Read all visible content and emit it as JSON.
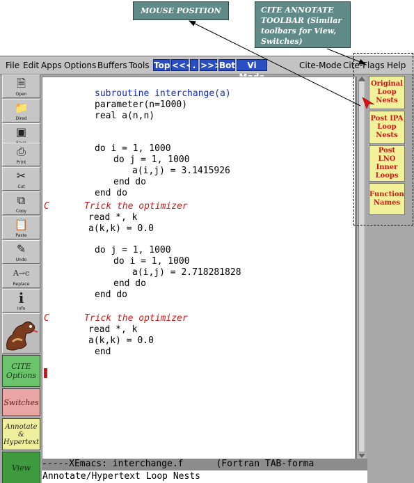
{
  "callouts": {
    "mouse_position": "MOUSE POSITION",
    "toolbar_lines": [
      "CITE ANNOTATE",
      "TOOLBAR (Similar",
      "toolbars for View,",
      "Switches)"
    ]
  },
  "menubar": {
    "items": [
      "File",
      "Edit",
      "Apps",
      "Options",
      "Buffers",
      "Tools"
    ],
    "buttons": [
      "Top",
      "<<<",
      ".",
      ">>>",
      "Bot",
      "Vi Mode"
    ],
    "right_items": [
      "Cite-Mode",
      "Cite-Flags",
      "Help"
    ]
  },
  "toolbar": {
    "tools": [
      {
        "label": "Open",
        "icon": "open-icon"
      },
      {
        "label": "Dired",
        "icon": "dired-icon"
      },
      {
        "label": "Save",
        "icon": "save-icon"
      },
      {
        "label": "Print",
        "icon": "print-icon"
      },
      {
        "label": "Cut",
        "icon": "cut-icon"
      },
      {
        "label": "Copy",
        "icon": "copy-icon"
      },
      {
        "label": "Paste",
        "icon": "paste-icon"
      },
      {
        "label": "Undo",
        "icon": "undo-icon"
      },
      {
        "label": "Replace",
        "icon": "replace-icon"
      },
      {
        "label": "Info",
        "icon": "info-icon"
      }
    ],
    "mascot": "xemacs-mascot",
    "cite_options": [
      "CITE",
      "Options"
    ],
    "switches": "Switches",
    "annotate": [
      "Annotate",
      "&",
      "Hypertext"
    ],
    "view": "View"
  },
  "editor": {
    "lines": [
      "subroutine interchange(a)",
      "parameter(n=1000)",
      "real a(n,n)",
      "do i = 1, 1000",
      "do j = 1, 1000",
      "a(i,j) = 3.1415926",
      "end do",
      "end do",
      "C",
      "Trick the optimizer",
      "read *, k",
      "a(k,k) = 0.0",
      "do j = 1, 1000",
      "do i = 1, 1000",
      "a(i,j) = 2.718281828",
      "end do",
      "end do",
      "C",
      "Trick the optimizer",
      "read *, k",
      "a(k,k) = 0.0",
      "end"
    ]
  },
  "modeline": "-----XEmacs: interchange.f      (Fortran TAB-forma",
  "minibuffer": "Annotate/Hypertext Loop Nests",
  "annotate_toolbar": {
    "buttons": [
      [
        "Original",
        "Loop",
        "Nests"
      ],
      [
        "Post IPA",
        "Loop",
        "Nests"
      ],
      [
        "Post LNO",
        "Inner",
        "Loops"
      ],
      [
        "Function",
        "Names"
      ]
    ]
  },
  "colors": {
    "callout": "#5f8a87",
    "menu_button": "#2a4ec2",
    "keyword": "#1028c8",
    "comment": "#d01a1a",
    "annotate_button": "#f1f19a",
    "cite_options": "#6bc46b",
    "switches": "#e9a4a4",
    "annotate": "#eeee9c",
    "view": "#3f9a3f"
  }
}
